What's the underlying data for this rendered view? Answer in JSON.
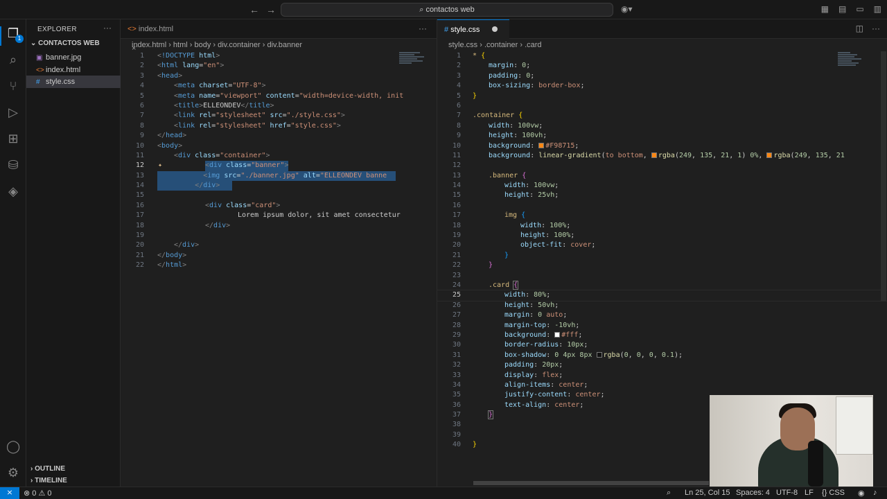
{
  "titlebar": {
    "command_center": "contactos web"
  },
  "sidebar": {
    "title": "EXPLORER",
    "folder": "CONTACTOS WEB",
    "files": [
      {
        "name": "banner.jpg",
        "icon": "image-file-icon"
      },
      {
        "name": "index.html",
        "icon": "html-file-icon"
      },
      {
        "name": "style.css",
        "icon": "css-file-icon"
      }
    ],
    "outline": "OUTLINE",
    "timeline": "TIMELINE",
    "explorer_badge": "1"
  },
  "left_editor": {
    "tab": "index.html",
    "breadcrumb": [
      "index.html",
      "html",
      "body",
      "div.container",
      "div.banner"
    ],
    "line_numbers": [
      "1",
      "2",
      "3",
      "4",
      "5",
      "6",
      "7",
      "8",
      "9",
      "10",
      "11",
      "12",
      "13",
      "14",
      "15",
      "16",
      "17",
      "18",
      "19",
      "20",
      "21",
      "22"
    ],
    "current_line": "12"
  },
  "right_editor": {
    "tab": "style.css",
    "breadcrumb": [
      "style.css",
      ".container",
      ".card"
    ],
    "line_numbers": [
      "1",
      "2",
      "3",
      "4",
      "5",
      "6",
      "7",
      "8",
      "9",
      "10",
      "11",
      "12",
      "13",
      "14",
      "15",
      "16",
      "17",
      "18",
      "19",
      "20",
      "21",
      "22",
      "23",
      "24",
      "25",
      "26",
      "27",
      "28",
      "29",
      "30",
      "31",
      "32",
      "33",
      "34",
      "35",
      "36",
      "37",
      "38",
      "39",
      "40"
    ],
    "current_line": "25"
  },
  "statusbar": {
    "errors": "0",
    "warnings": "0",
    "position": "Ln 25, Col 15",
    "spaces": "Spaces: 4",
    "encoding": "UTF-8",
    "eol": "LF",
    "language": "CSS"
  }
}
